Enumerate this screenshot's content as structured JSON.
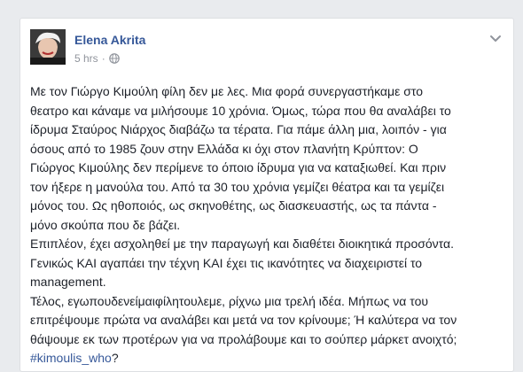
{
  "post": {
    "author": "Elena Akrita",
    "timestamp": "5 hrs",
    "separator": "·",
    "privacy_icon": "globe-icon",
    "menu_icon": "chevron-down-icon",
    "body": "Με τον Γιώργο Κιμούλη φίλη δεν με λες. Μια φορά συνεργαστήκαμε στο\nθεατρο και κάναμε να μιλήσουμε 10 χρόνια. Όμως, τώρα που θα αναλάβει το\nίδρυμα Σταύρος Νιάρχος διαβάζω τα τέρατα. Για πάμε άλλη μια, λοιπόν - για\nόσους από το 1985 ζουν στην Ελλάδα κι όχι στον πλανήτη Κρύπτον: Ο\nΓιώργος Κιμούλης δεν περίμενε το όποιο ίδρυμα για να καταξιωθεί. Και πριν\nτον ήξερε η μανούλα του. Από τα 30 του χρόνια γεμίζει θέατρα και τα γεμίζει\nμόνος του. Ως ηθοποιός, ως σκηνοθέτης, ως διασκευαστής, ως τα πάντα -\nμόνο σκούπα που δε βάζει.\nΕπιπλέον, έχει ασχοληθεί με την παραγωγή και διαθέτει διοικητικά προσόντα.\nΓενικώς ΚΑΙ αγαπάει την τέχνη ΚΑΙ έχει τις ικανότητες να διαχειριστεί το\nmanagement.\nΤέλος, εγωπουδενείμαιφίλητουλεμε, ρίχνω μια τρελή ιδέα. Μήπως να του\nεπιτρέψουμε πρώτα να αναλάβει και μετά να τον κρίνουμε; Ή καλύτερα να τον\nθάψουμε εκ των προτέρων για να προλάβουμε και το σούπερ μάρκετ ανοιχτό;\n",
    "hashtag": "#kimoulis_who",
    "hashtag_suffix": "?"
  }
}
